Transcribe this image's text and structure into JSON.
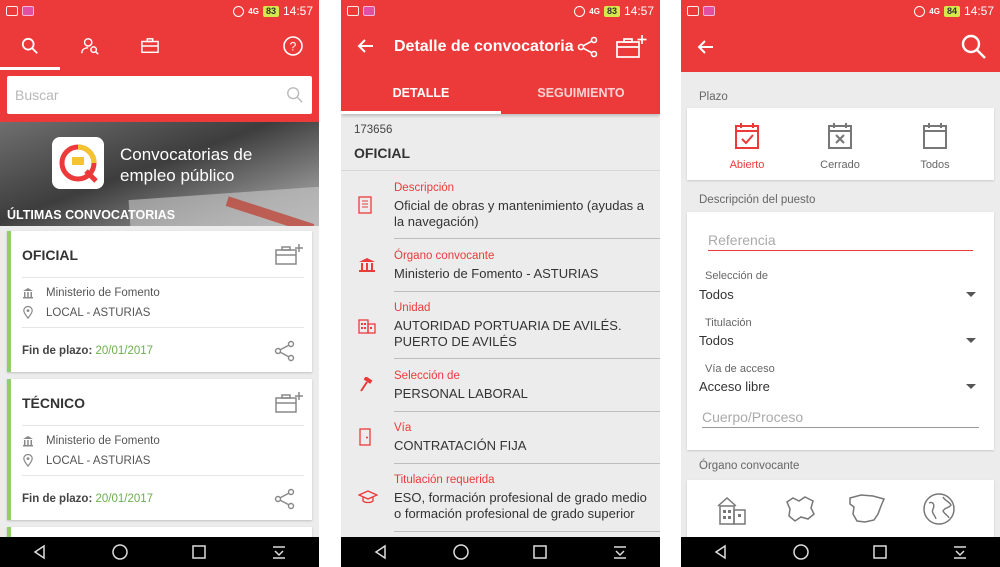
{
  "status_bar": {
    "time": "14:57",
    "signal": "4G",
    "battery_screen1": "83",
    "battery_screen2": "83",
    "battery_screen3": "84"
  },
  "colors": {
    "primary": "#ec3a3a",
    "accent_green": "#8fcf6a",
    "date_green": "#6ab04c"
  },
  "screen1": {
    "tabs": [
      "search-icon",
      "user-search-icon",
      "briefcase-icon",
      "help-icon"
    ],
    "search_placeholder": "Buscar",
    "app_title": "Convocatorias de empleo público",
    "section_title": "ÚLTIMAS CONVOCATORIAS",
    "cards": [
      {
        "title": "OFICIAL",
        "organism": "Ministerio de Fomento",
        "location": "LOCAL - ASTURIAS",
        "deadline_label": "Fin de plazo:",
        "deadline": "20/01/2017"
      },
      {
        "title": "TÉCNICO",
        "organism": "Ministerio de Fomento",
        "location": "LOCAL - ASTURIAS",
        "deadline_label": "Fin de plazo:",
        "deadline": "20/01/2017"
      }
    ]
  },
  "screen2": {
    "title": "Detalle de convocatoria",
    "tab_detail": "DETALLE",
    "tab_tracking": "SEGUIMIENTO",
    "code": "173656",
    "name": "OFICIAL",
    "rows": [
      {
        "label": "Descripción",
        "value": "Oficial de obras y mantenimiento (ayudas a la navegación)",
        "icon": "document-icon"
      },
      {
        "label": "Órgano convocante",
        "value": "Ministerio de Fomento - ASTURIAS",
        "icon": "institution-icon"
      },
      {
        "label": "Unidad",
        "value": "AUTORIDAD PORTUARIA DE AVILÉS. PUERTO DE AVILÉS",
        "icon": "building-icon"
      },
      {
        "label": "Selección de",
        "value": "PERSONAL LABORAL",
        "icon": "hammer-icon"
      },
      {
        "label": "Vía",
        "value": "CONTRATACIÓN FIJA",
        "icon": "door-icon"
      },
      {
        "label": "Titulación requerida",
        "value": "ESO, formación profesional de grado medio o formación profesional de grado superior",
        "icon": "graduation-cap-icon"
      }
    ]
  },
  "screen3": {
    "plazo_title": "Plazo",
    "plazo_options": [
      "Abierto",
      "Cerrado",
      "Todos"
    ],
    "description_title": "Descripción del puesto",
    "referencia_placeholder": "Referencia",
    "selects": [
      {
        "label": "Selección de",
        "value": "Todos"
      },
      {
        "label": "Titulación",
        "value": "Todos"
      },
      {
        "label": "Vía de acceso",
        "value": "Acceso libre"
      }
    ],
    "cuerpo_placeholder": "Cuerpo/Proceso",
    "organo_title": "Órgano convocante",
    "organo_icons": [
      "local-building-icon",
      "region-map-icon",
      "spain-map-icon",
      "globe-icon"
    ]
  }
}
